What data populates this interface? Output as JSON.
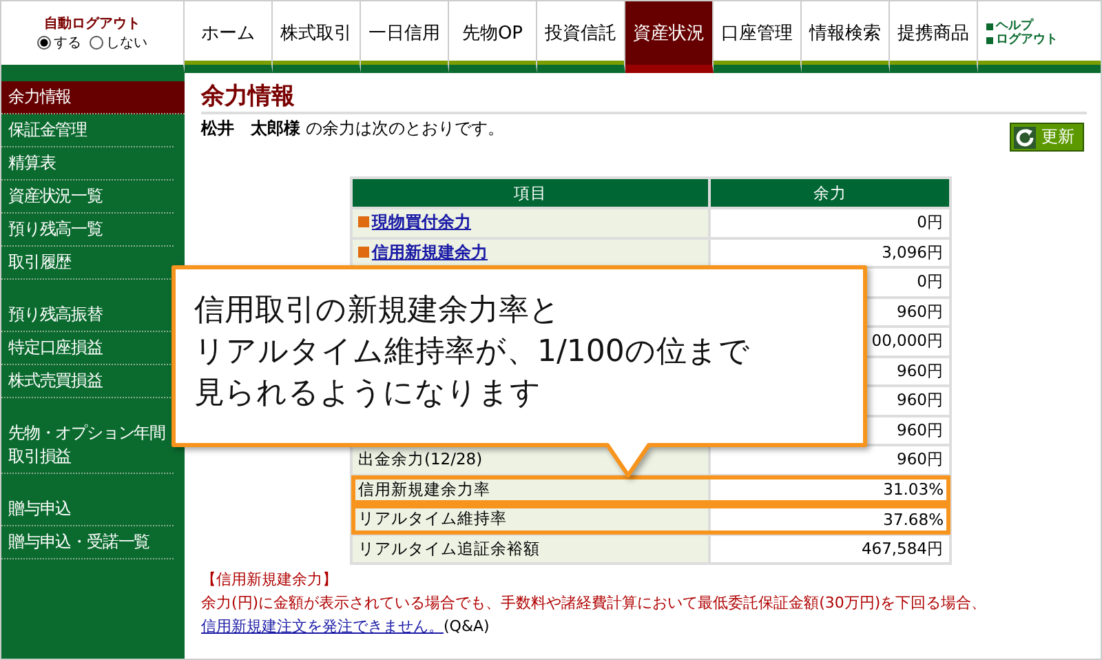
{
  "auto_logout": {
    "label": "自動ログアウト",
    "options": [
      {
        "label": "する",
        "selected": true
      },
      {
        "label": "しない",
        "selected": false
      }
    ]
  },
  "nav": {
    "tabs": [
      {
        "label": "ホーム",
        "selected": false
      },
      {
        "label": "株式取引",
        "selected": false
      },
      {
        "label": "一日信用",
        "selected": false
      },
      {
        "label": "先物OP",
        "selected": false
      },
      {
        "label": "投資信託",
        "selected": false
      },
      {
        "label": "資産状況",
        "selected": true
      },
      {
        "label": "口座管理",
        "selected": false
      },
      {
        "label": "情報検索",
        "selected": false
      },
      {
        "label": "提携商品",
        "selected": false
      }
    ],
    "links": [
      "ヘルプ",
      "ログアウト"
    ]
  },
  "sidebar": {
    "groups": [
      [
        {
          "label": "余力情報",
          "selected": true
        },
        {
          "label": "保証金管理",
          "selected": false
        },
        {
          "label": "精算表",
          "selected": false
        },
        {
          "label": "資産状況一覧",
          "selected": false
        },
        {
          "label": "預り残高一覧",
          "selected": false
        },
        {
          "label": "取引履歴",
          "selected": false
        }
      ],
      [
        {
          "label": "預り残高振替",
          "selected": false
        },
        {
          "label": "特定口座損益",
          "selected": false
        },
        {
          "label": "株式売買損益",
          "selected": false
        }
      ],
      [
        {
          "label": "先物・オプション年間取引損益",
          "selected": false
        }
      ],
      [
        {
          "label": "贈与申込",
          "selected": false
        },
        {
          "label": "贈与申込・受諾一覧",
          "selected": false
        }
      ]
    ]
  },
  "page": {
    "title": "余力情報",
    "greeting_name": "松井　太郎様",
    "greeting_text": "の余力は次のとおりです。",
    "refresh_button": "更新"
  },
  "table": {
    "columns": [
      "項目",
      "余力"
    ],
    "rows": [
      {
        "kind": "link",
        "item": "現物買付余力",
        "value": "0円",
        "highlighted": false
      },
      {
        "kind": "link",
        "item": "信用新規建余力",
        "value": "3,096円",
        "highlighted": false
      },
      {
        "kind": "plain",
        "value": "0円",
        "highlighted": false
      },
      {
        "kind": "plain",
        "value": "960円",
        "highlighted": false
      },
      {
        "kind": "plain",
        "value": "00,000円",
        "highlighted": false
      },
      {
        "kind": "plain",
        "value": "960円",
        "highlighted": false
      },
      {
        "kind": "plain",
        "value": "960円",
        "highlighted": false
      },
      {
        "kind": "plain",
        "value": "960円",
        "highlighted": false
      },
      {
        "kind": "plain",
        "item": "出金余力(12/28)",
        "value": "960円",
        "highlighted": false
      },
      {
        "kind": "plain",
        "item": "信用新規建余力率",
        "value": "31.03%",
        "highlighted": true
      },
      {
        "kind": "plain",
        "item": "リアルタイム維持率",
        "value": "37.68%",
        "highlighted": true
      },
      {
        "kind": "plain",
        "item": "リアルタイム追証余裕額",
        "value": "467,584円",
        "highlighted": false
      }
    ]
  },
  "note": {
    "heading": "【信用新規建余力】",
    "text": "余力(円)に金額が表示されている場合でも、手数料や諸経費計算において最低委託保証金額(30万円)を下回る場合、",
    "link": "信用新規建注文を発注できません。",
    "suffix": "(Q&A)"
  },
  "callout": {
    "lines": [
      "信用取引の新規建余力率と",
      "リアルタイム維持率が、1/100の位まで",
      "見られるようになります"
    ]
  }
}
